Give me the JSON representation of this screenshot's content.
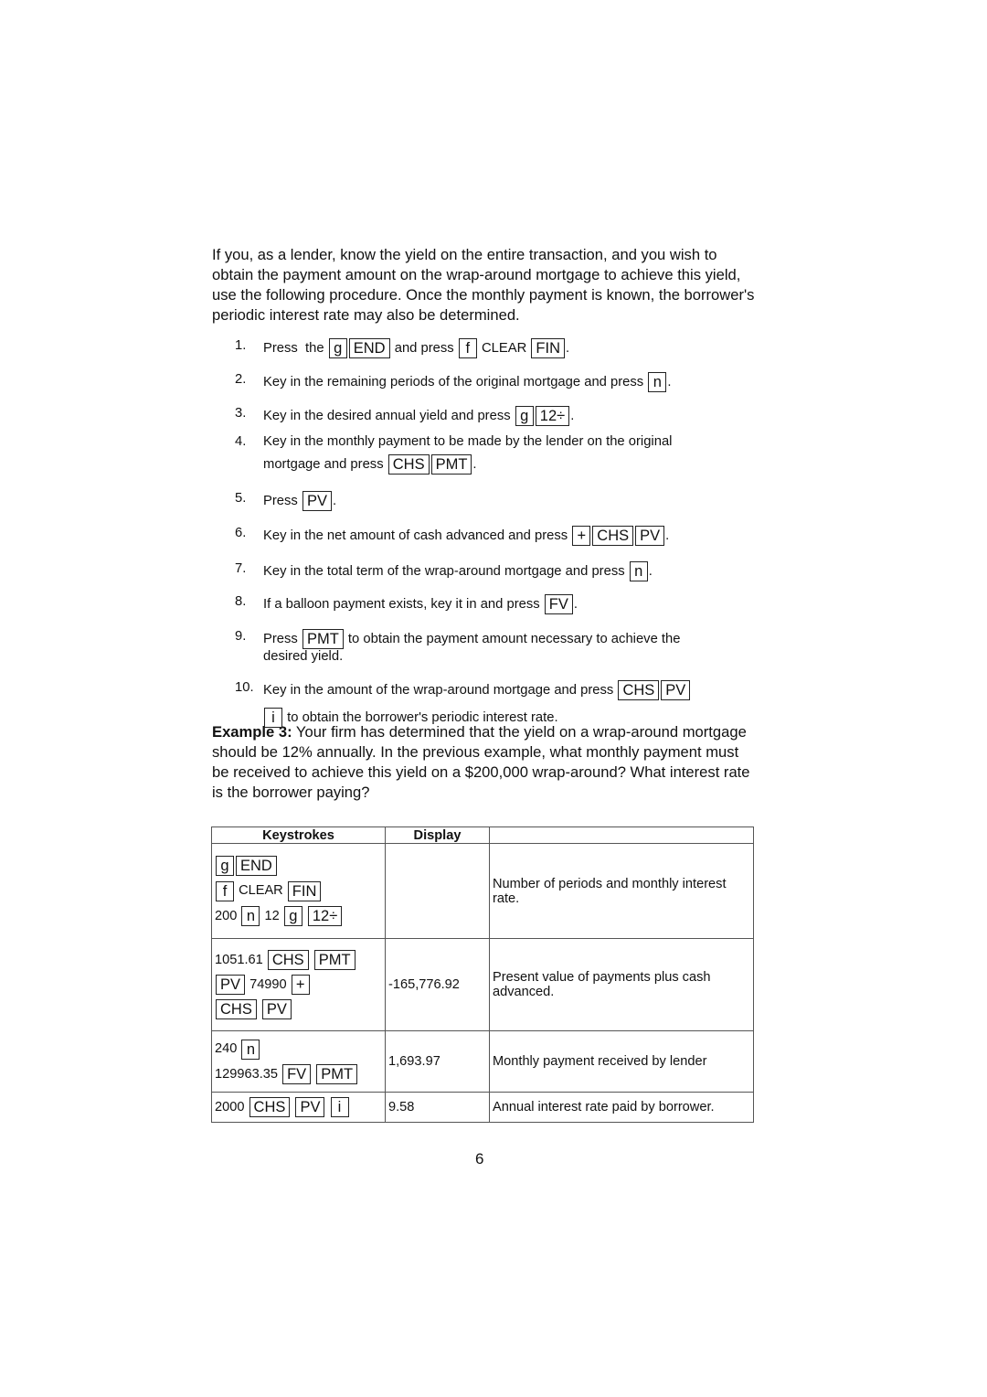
{
  "intro": "If you, as a lender, know the yield on the entire transaction, and you wish to obtain the payment amount on the wrap-around mortgage to achieve this yield, use the following procedure. Once the monthly payment is known, the borrower's periodic interest rate may also be determined.",
  "steps": [
    {
      "num": "1.",
      "a": "Press  the",
      "k1": "g",
      "k2": "END",
      "b": "and press",
      "k3": "f",
      "c": "CLEAR",
      "k4": "FIN",
      "end": "."
    },
    {
      "num": "2.",
      "a": "Key in the remaining periods of the original mortgage and press",
      "k1": "n",
      "end": "."
    },
    {
      "num": "3.",
      "a": "Key in the desired annual yield and press",
      "k1": "g",
      "k2": "12÷",
      "end": "."
    },
    {
      "num": "4.",
      "a": "Key in the monthly payment to be made by the lender on the original",
      "b": "mortgage and press",
      "k1": "CHS",
      "k2": "PMT",
      "end": "."
    },
    {
      "num": "5.",
      "a": "Press",
      "k1": "PV",
      "end": "."
    },
    {
      "num": "6.",
      "a": "Key in the net amount of cash advanced and press",
      "k1": "+",
      "k2": "CHS",
      "k3": "PV",
      "end": "."
    },
    {
      "num": "7.",
      "a": "Key in the total term of the wrap-around mortgage and press",
      "k1": "n",
      "end": "."
    },
    {
      "num": "8.",
      "a": "If a balloon payment exists, key it in and press",
      "k1": "FV",
      "end": "."
    },
    {
      "num": "9.",
      "a": "Press",
      "k1": "PMT",
      "b": "to obtain the payment amount necessary to achieve the",
      "c": "desired yield."
    },
    {
      "num": "10.",
      "a": "Key in the amount of the wrap-around mortgage and press",
      "k1": "CHS",
      "k2": "PV",
      "k3": "i",
      "b": "to obtain the borrower's periodic interest rate."
    }
  ],
  "example": {
    "label": "Example 3:",
    "text": " Your firm has determined that the yield on a wrap-around mortgage should be 12% annually. In the previous example, what monthly payment must be received to achieve this yield on a $200,000 wrap-around? What interest rate is the borrower paying?"
  },
  "table": {
    "headers": [
      "Keystrokes",
      "Display",
      ""
    ],
    "rows": [
      {
        "keys": {
          "l1": {
            "k1": "g",
            "k2": "END"
          },
          "l2": {
            "k1": "f",
            "t1": "CLEAR",
            "k2": "FIN"
          },
          "l3": {
            "t1": "200",
            "k1": "n",
            "t2": "12",
            "k2": "g",
            "k3": "12÷"
          }
        },
        "display": "",
        "note": "Number of periods and monthly interest rate."
      },
      {
        "keys": {
          "l1": {
            "t1": "1051.61",
            "k1": "CHS",
            "k2": "PMT"
          },
          "l2": {
            "k1": "PV",
            "t1": "74990",
            "k2": "+"
          },
          "l3": {
            "k1": "CHS",
            "k2": "PV"
          }
        },
        "display": "-165,776.92",
        "note": "Present value of payments plus cash advanced."
      },
      {
        "keys": {
          "l1": {
            "t1": "240",
            "k1": "n"
          },
          "l2": {
            "t1": "129963.35",
            "k1": "FV",
            "k2": "PMT"
          }
        },
        "display": "1,693.97",
        "note": "Monthly payment received by lender"
      },
      {
        "keys": {
          "l1": {
            "t1": "2000",
            "k1": "CHS",
            "k2": "PV",
            "k3": "i"
          }
        },
        "display": "9.58",
        "note": "Annual interest rate paid by borrower."
      }
    ]
  },
  "page_number": "6"
}
